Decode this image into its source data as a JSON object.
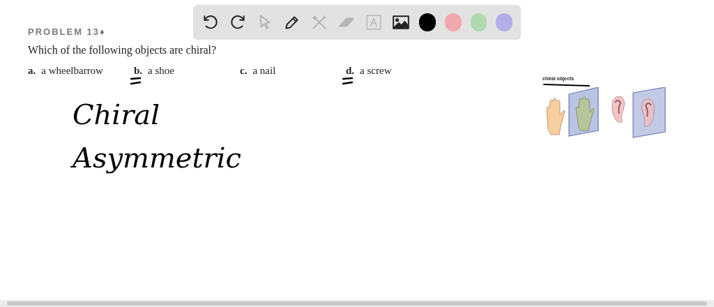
{
  "toolbar": {
    "tools": [
      {
        "kind": "undo",
        "disabled": false
      },
      {
        "kind": "redo",
        "disabled": false
      },
      {
        "kind": "select",
        "disabled": true
      },
      {
        "kind": "pen",
        "disabled": false
      },
      {
        "kind": "tools",
        "disabled": true
      },
      {
        "kind": "eraser",
        "disabled": true
      },
      {
        "kind": "text",
        "disabled": true
      },
      {
        "kind": "image",
        "disabled": false
      }
    ],
    "colors": [
      {
        "color": "#000000"
      },
      {
        "color": "#f0a8ae"
      },
      {
        "color": "#b0d9b0"
      },
      {
        "color": "#b4aee8"
      }
    ]
  },
  "problem": {
    "heading": "PROBLEM 13♦",
    "question": "Which of the following objects are chiral?",
    "options": [
      {
        "letter": "a.",
        "text": "a wheelbarrow",
        "marked": false
      },
      {
        "letter": "b.",
        "text": "a shoe",
        "marked": true
      },
      {
        "letter": "c.",
        "text": "a nail",
        "marked": false
      },
      {
        "letter": "d.",
        "text": "a screw",
        "marked": true
      }
    ]
  },
  "handwriting": [
    "Chiral",
    "Asymmetric"
  ],
  "figure": {
    "label": "chiral objects"
  }
}
